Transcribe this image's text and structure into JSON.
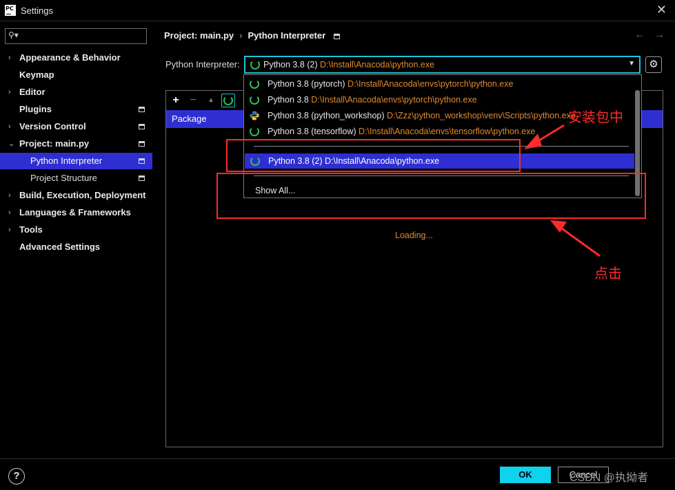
{
  "window": {
    "app_icon": "PC",
    "title": "Settings",
    "close_glyph": "✕"
  },
  "search": {
    "placeholder": "",
    "value": "",
    "icon": "search-icon"
  },
  "sidebar": {
    "items": [
      {
        "label": "Appearance & Behavior",
        "arrow": "›",
        "bold": true
      },
      {
        "label": "Keymap",
        "bold": true
      },
      {
        "label": "Editor",
        "arrow": "›",
        "bold": true
      },
      {
        "label": "Plugins",
        "bold": true,
        "project_icon": true
      },
      {
        "label": "Version Control",
        "arrow": "›",
        "bold": true,
        "project_icon": true
      },
      {
        "label": "Project: main.py",
        "arrow": "⌄",
        "bold": true,
        "project_icon": true
      },
      {
        "label": "Python Interpreter",
        "child": true,
        "selected": true,
        "project_icon": true
      },
      {
        "label": "Project Structure",
        "child": true,
        "project_icon": true
      },
      {
        "label": "Build, Execution, Deployment",
        "arrow": "›",
        "bold": true
      },
      {
        "label": "Languages & Frameworks",
        "arrow": "›",
        "bold": true
      },
      {
        "label": "Tools",
        "arrow": "›",
        "bold": true
      },
      {
        "label": "Advanced Settings",
        "bold": true
      }
    ]
  },
  "breadcrumb": {
    "project": "Project: main.py",
    "separator": "›",
    "page": "Python Interpreter"
  },
  "nav": {
    "back": "←",
    "forward": "→"
  },
  "interpreter": {
    "label": "Python Interpreter:",
    "selected_name": "Python 3.8 (2)",
    "selected_path": "D:\\Install\\Anacoda\\python.exe",
    "caret": "▼",
    "gear": "⚙"
  },
  "dropdown": {
    "items": [
      {
        "name": "Python 3.8 (pytorch)",
        "path": "D:\\Install\\Anacoda\\envs\\pytorch\\python.exe",
        "icon": "spinner"
      },
      {
        "name": "Python 3.8",
        "path": "D:\\Install\\Anacoda\\envs\\pytorch\\python.exe",
        "icon": "spinner"
      },
      {
        "name": "Python 3.8 (python_workshop)",
        "path": "D:\\Zzz\\python_workshop\\venv\\Scripts\\python.exe",
        "icon": "python-logo"
      },
      {
        "name": "Python 3.8 (tensorflow)",
        "path": "D:\\Install\\Anacoda\\envs\\tensorflow\\python.exe",
        "icon": "spinner"
      },
      {
        "name": "Python 3.8 (2)",
        "path": "D:\\Install\\Anacoda\\python.exe",
        "icon": "spinner",
        "selected": true
      }
    ],
    "show_all": "Show All..."
  },
  "packages": {
    "toolbar": {
      "add": "+",
      "remove": "−",
      "up": "▲"
    },
    "column_header": "Package",
    "loading": "Loading..."
  },
  "annotations": {
    "installing_label": "安装包中",
    "click_label": "点击",
    "color": "#ff2a2a"
  },
  "footer": {
    "help": "?",
    "ok": "OK",
    "cancel": "Cancel",
    "watermark": "CSDN @执拗者"
  },
  "colors": {
    "accent_cyan": "#0fd2ec",
    "selection_blue": "#2f2fd1",
    "path_orange": "#e08a32",
    "spinner_green": "#2fc05a"
  }
}
